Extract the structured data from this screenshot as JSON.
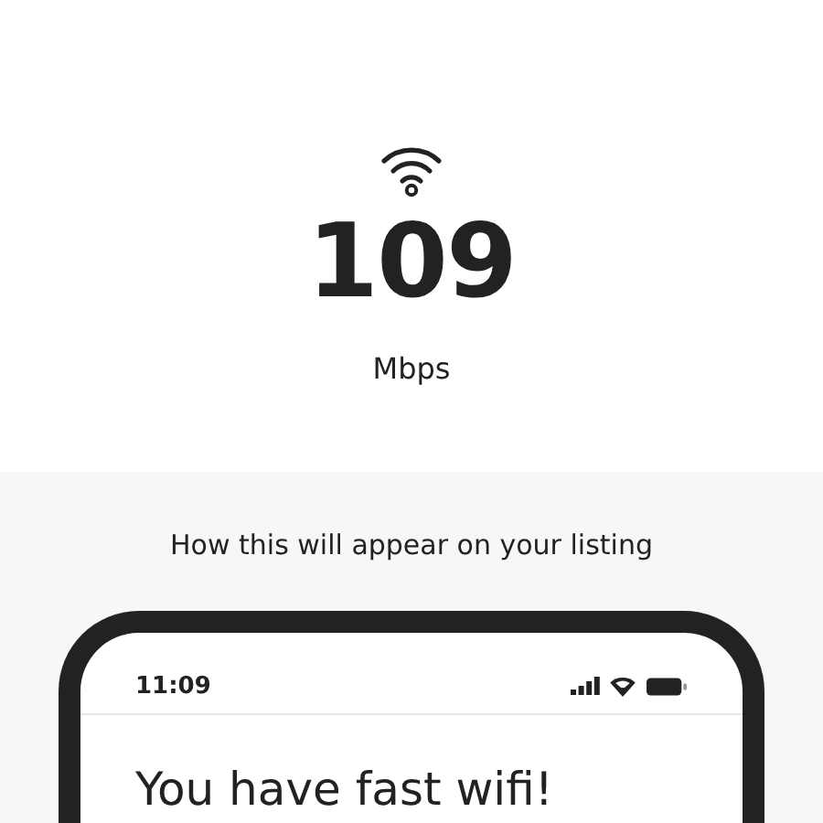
{
  "speed": {
    "value": "109",
    "unit": "Mbps"
  },
  "preview": {
    "caption": "How this will appear on your listing",
    "phone": {
      "time": "11:09",
      "heading": "You have fast wifi!"
    }
  }
}
